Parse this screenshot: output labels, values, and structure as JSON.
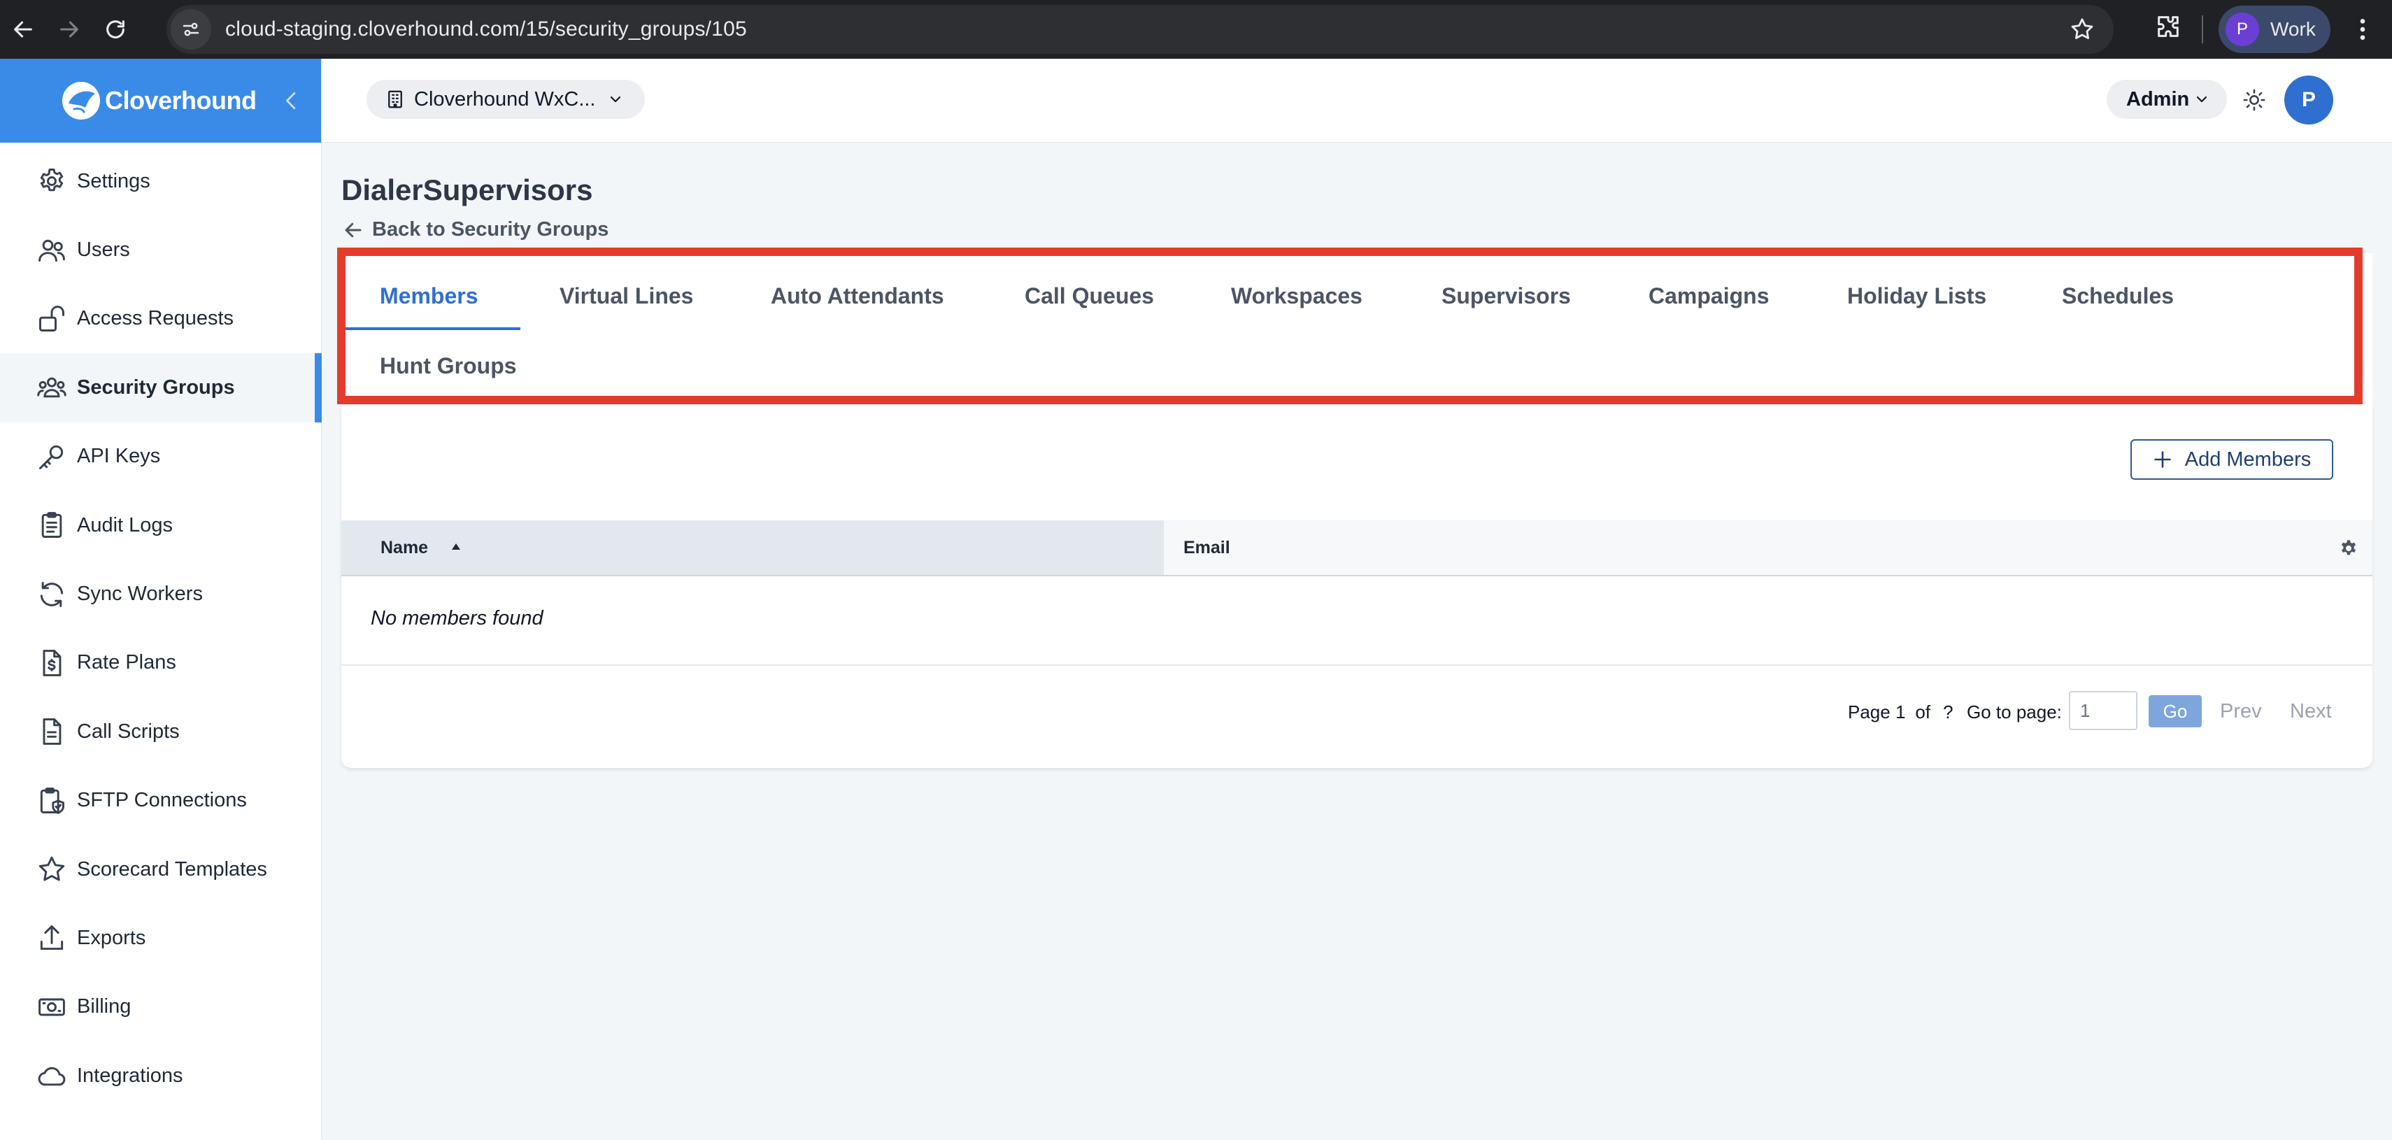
{
  "browser": {
    "url": "cloud-staging.cloverhound.com/15/security_groups/105",
    "profile_initial": "P",
    "profile_name": "Work"
  },
  "brand": {
    "name": "Cloverhound"
  },
  "sidebar": {
    "items": [
      {
        "label": "Settings",
        "icon": "gear-icon"
      },
      {
        "label": "Users",
        "icon": "users-icon"
      },
      {
        "label": "Access Requests",
        "icon": "unlock-icon"
      },
      {
        "label": "Security Groups",
        "icon": "group-icon",
        "active": true
      },
      {
        "label": "API Keys",
        "icon": "key-icon"
      },
      {
        "label": "Audit Logs",
        "icon": "clipboard-icon"
      },
      {
        "label": "Sync Workers",
        "icon": "sync-icon"
      },
      {
        "label": "Rate Plans",
        "icon": "dollar-doc-icon"
      },
      {
        "label": "Call Scripts",
        "icon": "document-icon"
      },
      {
        "label": "SFTP Connections",
        "icon": "shield-doc-icon"
      },
      {
        "label": "Scorecard Templates",
        "icon": "star-icon"
      },
      {
        "label": "Exports",
        "icon": "upload-icon"
      },
      {
        "label": "Billing",
        "icon": "money-icon"
      },
      {
        "label": "Integrations",
        "icon": "cloud-icon"
      }
    ]
  },
  "header": {
    "org_name": "Cloverhound WxC...",
    "role": "Admin",
    "avatar_initial": "P"
  },
  "main": {
    "title": "DialerSupervisors",
    "back_label": "Back to Security Groups",
    "tabs": [
      {
        "label": "Members",
        "active": true
      },
      {
        "label": "Virtual Lines"
      },
      {
        "label": "Auto Attendants"
      },
      {
        "label": "Call Queues"
      },
      {
        "label": "Workspaces"
      },
      {
        "label": "Supervisors"
      },
      {
        "label": "Campaigns"
      },
      {
        "label": "Holiday Lists"
      },
      {
        "label": "Schedules"
      },
      {
        "label": "Hunt Groups"
      }
    ],
    "add_button_label": "Add Members",
    "table": {
      "columns": [
        "Name",
        "Email"
      ],
      "sorted_column": "Name",
      "sort_direction": "ascending",
      "empty_text": "No members found"
    },
    "pagination": {
      "page_label": "Page 1",
      "of_label": "of",
      "total": "?",
      "goto_label": "Go to page:",
      "goto_value": "1",
      "go_label": "Go",
      "prev_label": "Prev",
      "next_label": "Next"
    }
  },
  "colors": {
    "brand_blue": "#3a8be8",
    "accent_blue": "#2f6fd0",
    "highlight_red": "#e53b2c"
  }
}
